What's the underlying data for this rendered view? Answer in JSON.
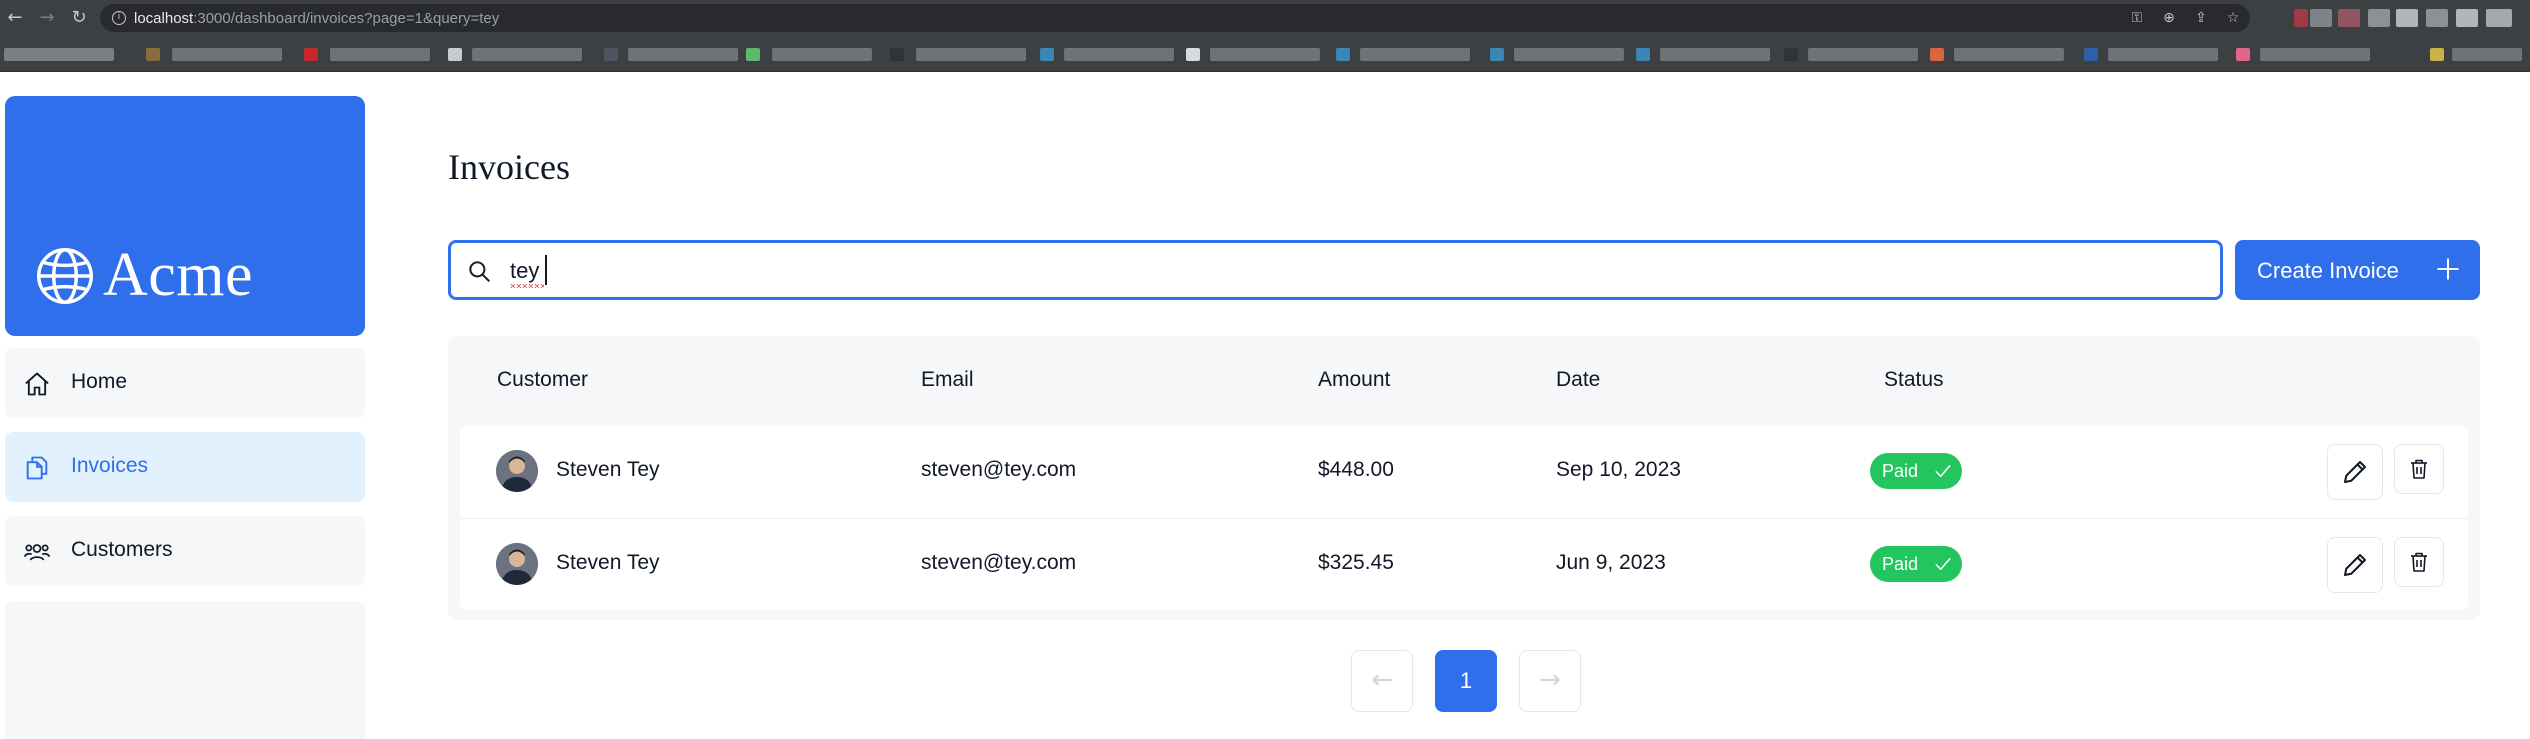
{
  "browser": {
    "url_host": "localhost",
    "url_rest": ":3000/dashboard/invoices?page=1&query=tey"
  },
  "sidebar": {
    "logo_text": "Acme",
    "items": [
      {
        "label": "Home",
        "icon": "home-icon",
        "active": false
      },
      {
        "label": "Invoices",
        "icon": "document-duplicate-icon",
        "active": true
      },
      {
        "label": "Customers",
        "icon": "user-group-icon",
        "active": false
      }
    ]
  },
  "main": {
    "title": "Invoices",
    "search": {
      "value": "tey"
    },
    "create_button": {
      "label": "Create Invoice"
    }
  },
  "table": {
    "columns": [
      "Customer",
      "Email",
      "Amount",
      "Date",
      "Status"
    ],
    "rows": [
      {
        "customer": "Steven Tey",
        "email": "steven@tey.com",
        "amount": "$448.00",
        "date": "Sep 10, 2023",
        "status": "Paid"
      },
      {
        "customer": "Steven Tey",
        "email": "steven@tey.com",
        "amount": "$325.45",
        "date": "Jun 9, 2023",
        "status": "Paid"
      }
    ]
  },
  "pagination": {
    "current_page": "1",
    "prev_arrow": "←",
    "next_arrow": "→"
  },
  "colors": {
    "accent": "#2f6feb",
    "paid": "#22c55e",
    "active_nav_bg": "#e1f1fd"
  }
}
